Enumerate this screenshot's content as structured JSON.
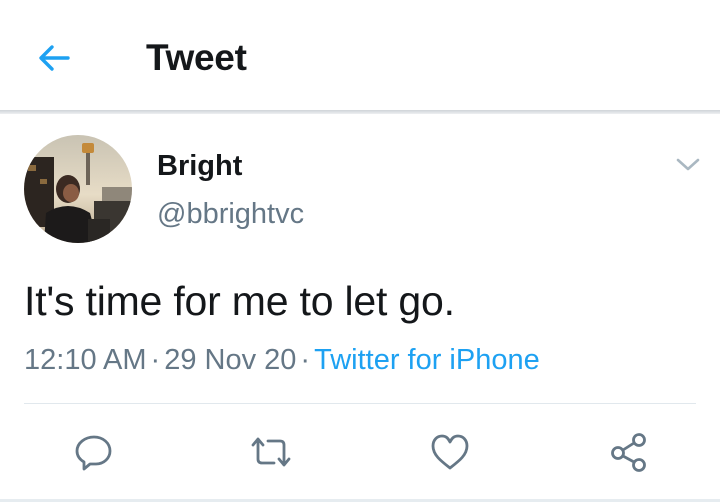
{
  "header": {
    "title": "Tweet",
    "back_icon": "arrow-left-icon",
    "accent_color": "#1da1f2"
  },
  "tweet": {
    "author": {
      "name": "Bright",
      "handle": "@bbrightvc",
      "avatar_icon": "profile-photo"
    },
    "text": "It's time for me to let go.",
    "time": "12:10 AM",
    "date": "29 Nov 20",
    "separator": "·",
    "source": "Twitter for iPhone",
    "menu_icon": "chevron-down-icon"
  },
  "actions": [
    {
      "name": "reply",
      "icon": "reply-icon"
    },
    {
      "name": "retweet",
      "icon": "retweet-icon"
    },
    {
      "name": "like",
      "icon": "heart-icon"
    },
    {
      "name": "share",
      "icon": "share-icon"
    }
  ],
  "colors": {
    "text_primary": "#14171a",
    "text_secondary": "#657786",
    "link": "#1da1f2",
    "divider": "#e1e8ed"
  }
}
